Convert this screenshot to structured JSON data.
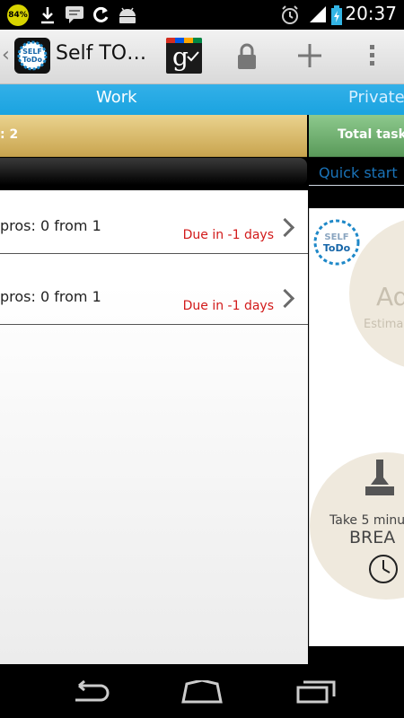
{
  "status_bar": {
    "battery_percent": "84%",
    "time": "20:37"
  },
  "action_bar": {
    "title": "Self TO…",
    "logo_text_top": "SELF",
    "logo_text_bottom": "ToDo",
    "gplus_label": "g"
  },
  "tabs": [
    {
      "label": "Work",
      "selected": true
    },
    {
      "label": "Private",
      "selected": false
    }
  ],
  "stats": {
    "left_text": ": 2",
    "right_text": "Total tasks"
  },
  "quick_start": "Quick start",
  "tasks": [
    {
      "pomos": "pros: 0 from 1",
      "due": "Due in -1 days"
    },
    {
      "pomos": "pros: 0 from 1",
      "due": "Due in -1 days"
    }
  ],
  "right_panel": {
    "logo_top": "SELF",
    "logo_bottom": "ToDo",
    "add_text": "Ad",
    "estimate_text": "Estima",
    "break_top": "Take 5 minu",
    "break_bottom": "BREA"
  },
  "colors": {
    "tab_bar": "#1aa3e0",
    "due_red": "#d21a1a",
    "link_blue": "#1a73b8"
  }
}
